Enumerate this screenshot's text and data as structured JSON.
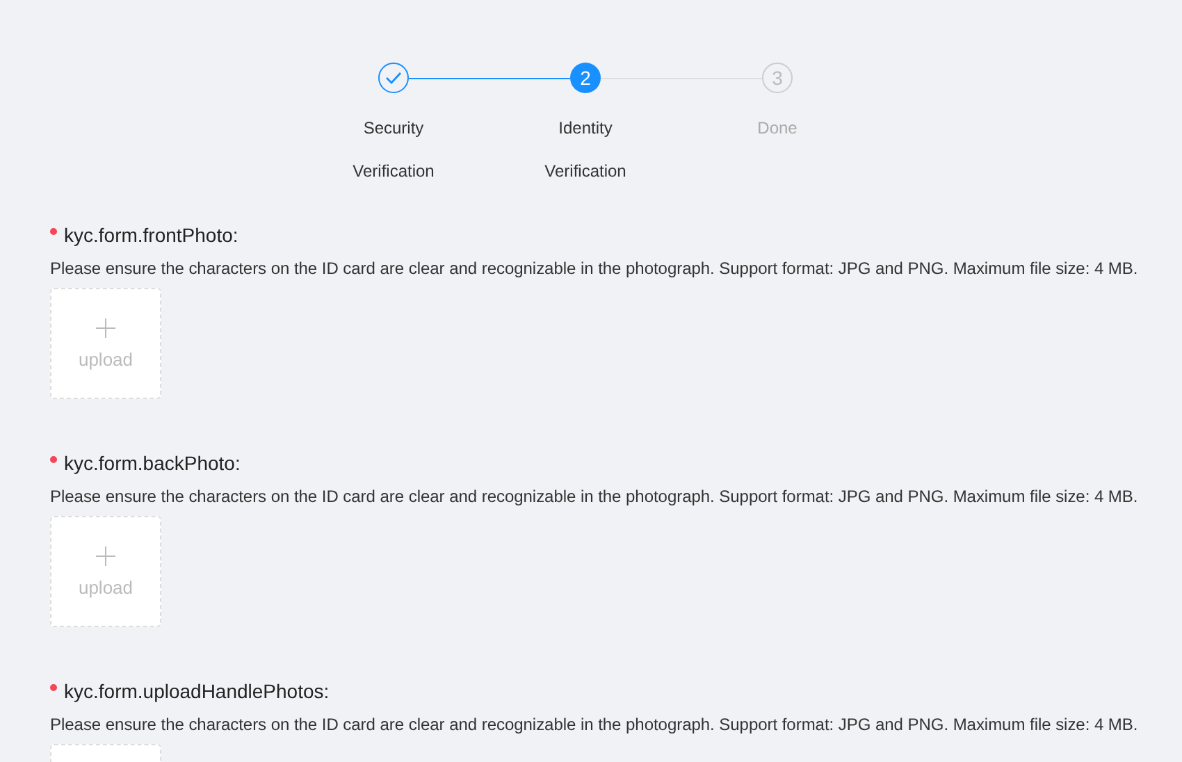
{
  "steps": [
    {
      "title": "Security Verification",
      "kind": "finish"
    },
    {
      "number": "2",
      "title": "Identity Verification",
      "kind": "process"
    },
    {
      "number": "3",
      "title": "Done",
      "kind": "wait"
    }
  ],
  "fields": [
    {
      "label": "kyc.form.frontPhoto:",
      "required": true,
      "help": "Please ensure the characters on the ID card are clear and recognizable in the photograph. Support format: JPG and PNG. Maximum file size: 4 MB.",
      "upload_label": "upload"
    },
    {
      "label": "kyc.form.backPhoto:",
      "required": true,
      "help": "Please ensure the characters on the ID card are clear and recognizable in the photograph. Support format: JPG and PNG. Maximum file size: 4 MB.",
      "upload_label": "upload"
    },
    {
      "label": "kyc.form.uploadHandlePhotos:",
      "required": true,
      "help": "Please ensure the characters on the ID card are clear and recognizable in the photograph. Support format: JPG and PNG. Maximum file size: 4 MB."
    }
  ]
}
